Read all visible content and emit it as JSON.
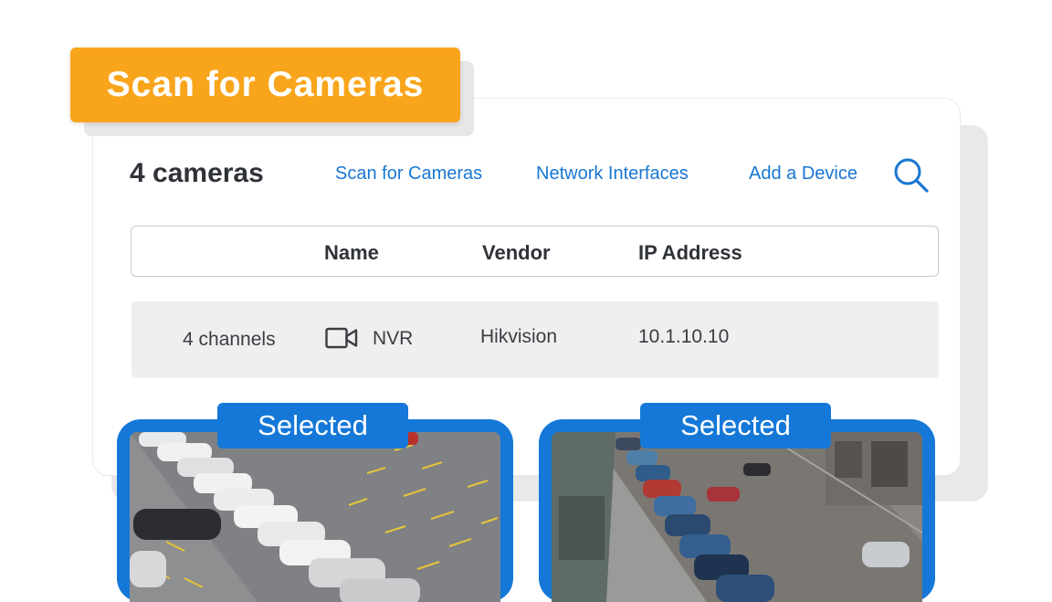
{
  "header": {
    "badge_title": "Scan for Cameras"
  },
  "toolbar": {
    "count_label": "4 cameras",
    "links": [
      "Scan for Cameras",
      "Network Interfaces",
      "Add a Device"
    ],
    "search_icon": "search-icon"
  },
  "table": {
    "columns": [
      "Name",
      "Vendor",
      "IP Address"
    ],
    "rows": [
      {
        "channels": "4 channels",
        "icon": "video-camera-icon",
        "name": "NVR",
        "vendor": "Hikvision",
        "ip": "10.1.10.10"
      }
    ]
  },
  "cameras": [
    {
      "tag": "Selected",
      "scene": "parking-lot"
    },
    {
      "tag": "Selected",
      "scene": "street"
    }
  ],
  "colors": {
    "accent_orange": "#f9a51c",
    "accent_blue": "#1578d8",
    "link_blue": "#1877d2"
  }
}
